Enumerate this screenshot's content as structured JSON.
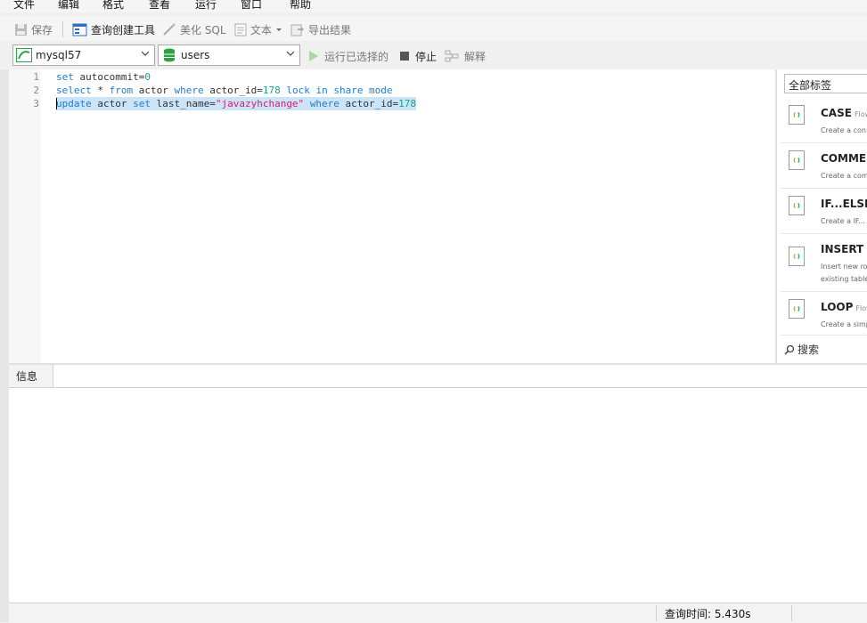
{
  "menu": [
    "文件",
    "编辑",
    "格式",
    "查看",
    "运行",
    "窗口",
    "帮助"
  ],
  "toolbar": {
    "save": "保存",
    "query_builder": "查询创建工具",
    "beautify": "美化 SQL",
    "text": "文本",
    "export": "导出结果"
  },
  "selectors": {
    "connection": "mysql57",
    "database": "users",
    "run_selected": "运行已选择的",
    "stop": "停止",
    "explain": "解释"
  },
  "editor": {
    "line_numbers": [
      "1",
      "2",
      "3"
    ],
    "line1": {
      "kw1": "set",
      "t1": " autocommit=",
      "n1": "0"
    },
    "line2": {
      "kw1": "select",
      "t1": " * ",
      "kw2": "from",
      "t2": " actor ",
      "kw3": "where",
      "t3": " actor_id=",
      "n1": "178",
      "t4": " ",
      "kw4": "lock in share mode"
    },
    "line3": {
      "kw1": "update",
      "t1": " actor ",
      "kw2": "set",
      "t2": " last_name=",
      "s1": "\"javazyhchange\"",
      "t3": " ",
      "kw3": "where",
      "t4": " actor_id=",
      "n1": "178"
    }
  },
  "snippets": {
    "filter": "全部标签",
    "items": [
      {
        "title": "CASE",
        "tag": "Flow",
        "desc": [
          "Create a con"
        ]
      },
      {
        "title": "COMMEN",
        "tag": "",
        "desc": [
          "Create a com"
        ]
      },
      {
        "title": "IF...ELSE...",
        "tag": "",
        "desc": [
          "Create a IF..."
        ]
      },
      {
        "title": "INSERT S",
        "tag": "",
        "desc": [
          "Insert new ro",
          "existing table"
        ]
      },
      {
        "title": "LOOP",
        "tag": "Flow",
        "desc": [
          "Create a simp"
        ]
      }
    ],
    "search": "搜索"
  },
  "bottom": {
    "tab_info": "信息",
    "status_time": "查询时间: 5.430s"
  },
  "colors": {
    "keyword": "#1e7bd6",
    "number": "#17a589",
    "string": "#d11f6a",
    "selection": "#cce4f7",
    "db_icon": "#2ea043"
  }
}
